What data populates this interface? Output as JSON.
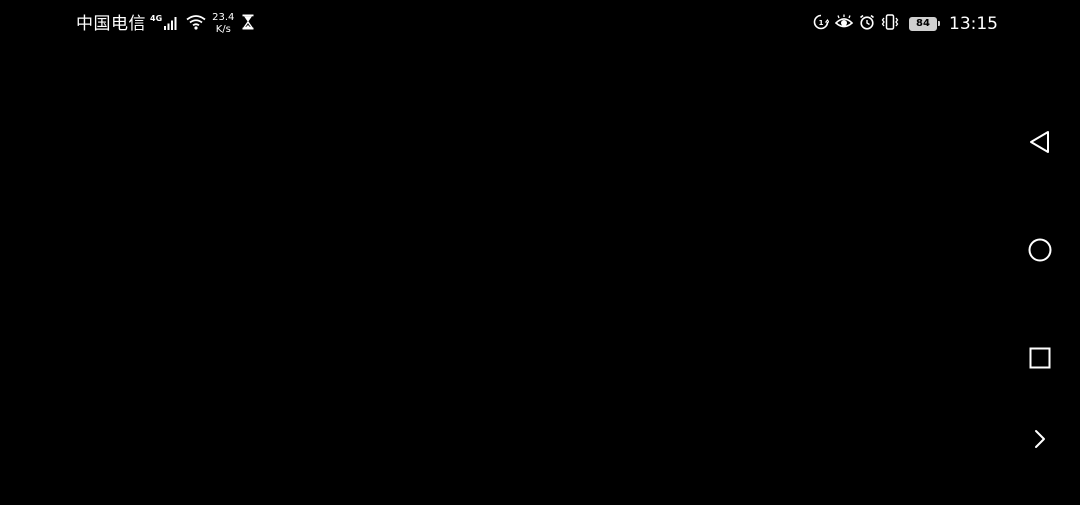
{
  "status_bar": {
    "carrier": "中国电信",
    "network_type": "4G",
    "speed_value": "23.4",
    "speed_unit": "K/s",
    "battery_level": "84",
    "time": "13:15",
    "icons": {
      "left": [
        "signal-icon",
        "wifi-icon",
        "hourglass-icon"
      ],
      "right": [
        "data-saver-icon",
        "eye-comfort-icon",
        "alarm-icon",
        "vibrate-icon",
        "battery-icon"
      ]
    }
  },
  "nav_bar": {
    "buttons": [
      "back-icon",
      "home-icon",
      "recents-icon",
      "expand-icon"
    ]
  },
  "colors": {
    "background": "#000000",
    "foreground": "#ffffff",
    "battery": "#cfcfcf"
  }
}
